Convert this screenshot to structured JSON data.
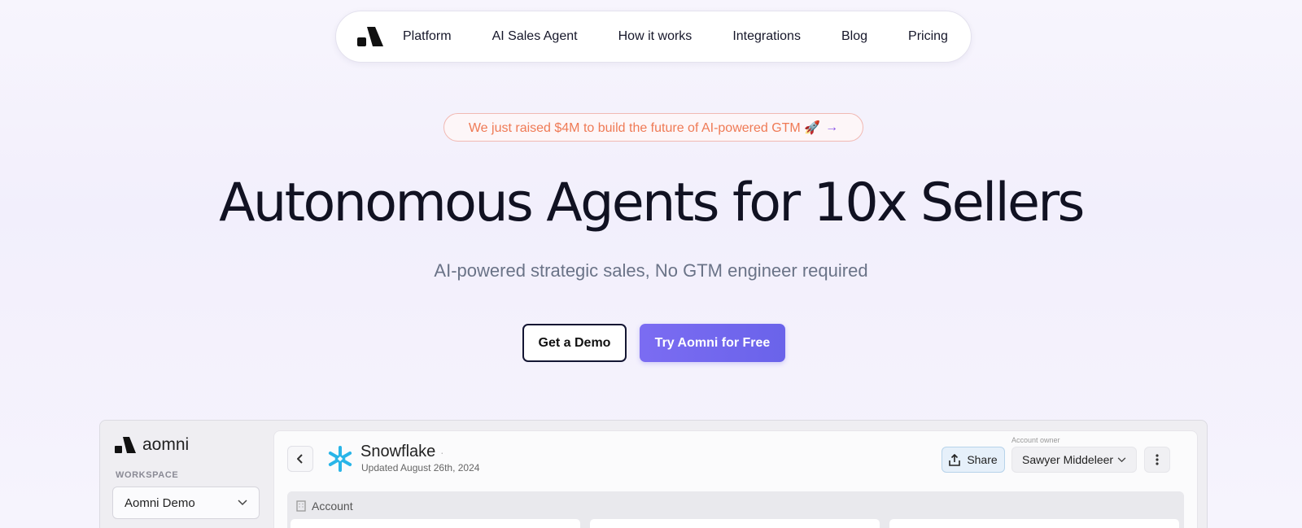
{
  "nav": {
    "items": [
      "Platform",
      "AI Sales Agent",
      "How it works",
      "Integrations",
      "Blog",
      "Pricing"
    ]
  },
  "banner": {
    "text": "We just raised $4M to build the future of AI-powered GTM 🚀",
    "arrow": "→"
  },
  "hero": {
    "title": "Autonomous Agents for 10x Sellers",
    "subtitle": "AI-powered strategic sales, No GTM engineer required",
    "demo_label": "Get a Demo",
    "try_label": "Try Aomni for Free"
  },
  "app": {
    "brand": "aomni",
    "workspace_label": "WORKSPACE",
    "workspace_value": "Aomni Demo",
    "account_name": "Snowflake",
    "account_dot": "·",
    "updated": "Updated August 26th, 2024",
    "share_label": "Share",
    "owner_label": "Account owner",
    "owner_value": "Sawyer Middeleer",
    "section_label": "Account"
  },
  "colors": {
    "accent": "#6a63ea",
    "banner_text": "#ef7a55",
    "snowflake": "#29b5e8"
  }
}
